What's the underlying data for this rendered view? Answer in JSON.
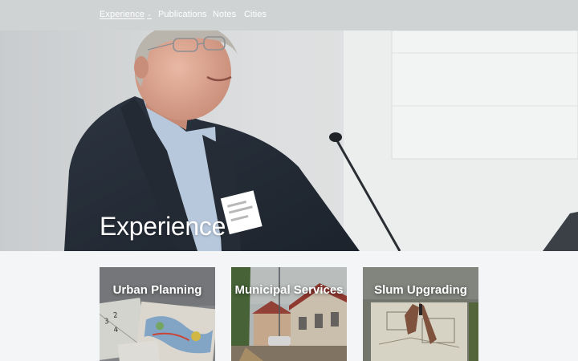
{
  "nav": {
    "items": [
      {
        "label": "Experience",
        "active": true,
        "has_dropdown": true
      },
      {
        "label": "Publications"
      },
      {
        "label": "Notes"
      },
      {
        "label": "Cities"
      }
    ]
  },
  "hero": {
    "title": "Experience"
  },
  "cards": [
    {
      "title": "Urban Planning"
    },
    {
      "title": "Municipal Services"
    },
    {
      "title": "Slum Upgrading"
    }
  ],
  "colors": {
    "nav_background": "#cfd3d4",
    "page_background": "#f3f5f6",
    "text_on_image": "#ffffff"
  },
  "icons": {
    "dropdown": "chevron-down-icon"
  }
}
